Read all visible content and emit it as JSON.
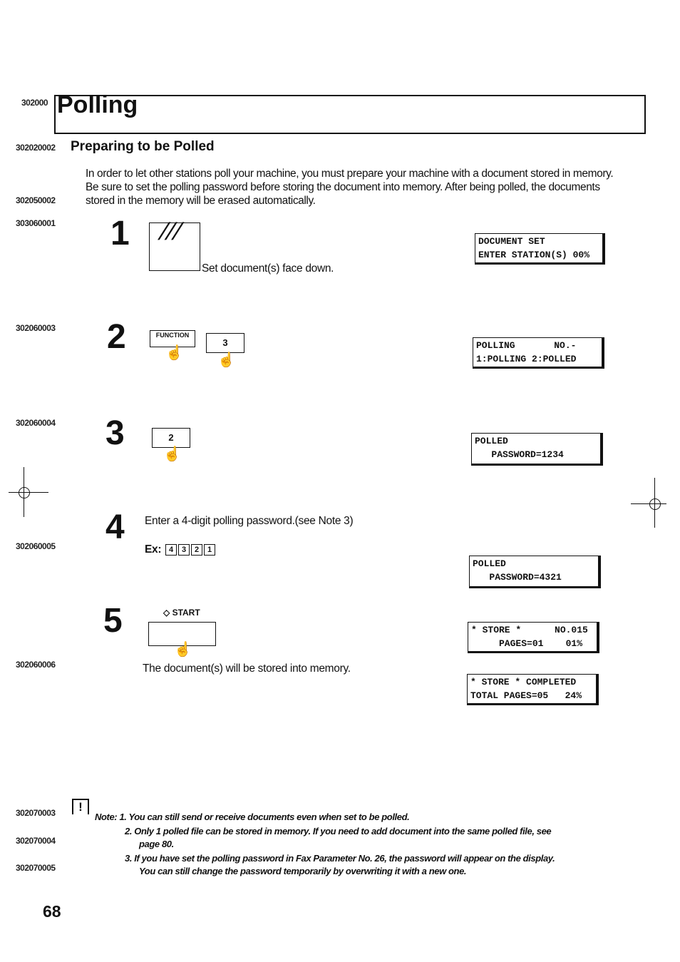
{
  "title": "Polling",
  "section_heading": "Preparing to be Polled",
  "intro": "In order to let other stations poll your machine, you must prepare your machine with a document stored in memory.  Be sure to set the polling password before storing the document into memory.  After being polled, the documents stored in the memory will be erased automatically.",
  "margin_codes": [
    "302000",
    "302020002",
    "302050002",
    "303060001",
    "302060003",
    "302060004",
    "302060005",
    "302060006",
    "302070003",
    "302070004",
    "302070005"
  ],
  "steps": [
    {
      "number": "1",
      "text": "Set document(s) face down.",
      "display": [
        "DOCUMENT SET",
        "ENTER STATION(S) 00%"
      ]
    },
    {
      "number": "2",
      "keys": [
        "FUNCTION",
        "3"
      ],
      "display": [
        "POLLING       NO.-",
        "1:POLLING 2:POLLED"
      ]
    },
    {
      "number": "3",
      "keys": [
        "2"
      ],
      "display": [
        "POLLED",
        "   PASSWORD=1234"
      ]
    },
    {
      "number": "4",
      "text": "Enter a 4-digit polling password.(see Note 3)",
      "example_label": "Ex:",
      "example_keys": [
        "4",
        "3",
        "2",
        "1"
      ],
      "display": [
        "POLLED",
        "   PASSWORD=4321"
      ]
    },
    {
      "number": "5",
      "key_label": "START",
      "text": "The document(s) will be stored into memory.",
      "display": [
        "* STORE *      NO.015",
        "     PAGES=01    01%"
      ],
      "display2": [
        "* STORE * COMPLETED",
        "TOTAL PAGES=05   24%"
      ]
    }
  ],
  "notes": {
    "label": "Note:",
    "items": [
      "1. You can still send or receive documents even when set to be polled.",
      "2. Only 1 polled file can be stored in memory. If you need to add document into the same polled file, see",
      "page 80.",
      "3. If you have set the polling password in Fax Parameter No. 26, the password will appear on the display.",
      "You can still change the password temporarily by overwriting it with a new one."
    ]
  },
  "page_number": "68"
}
